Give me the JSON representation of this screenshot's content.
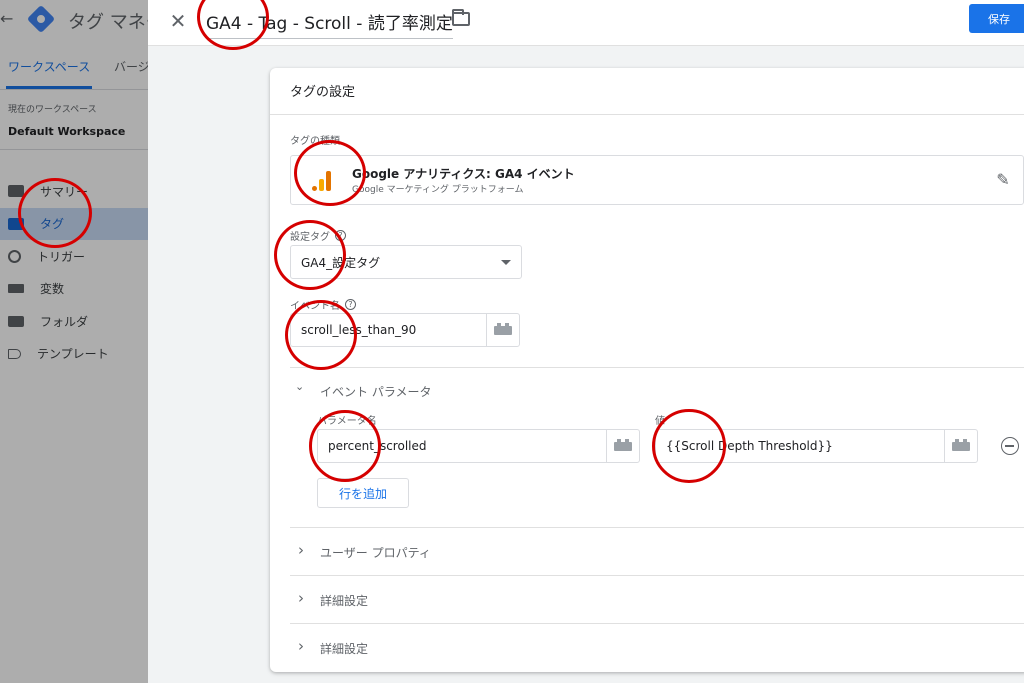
{
  "background_app": {
    "back_glyph": "←",
    "title": "タグ マネー",
    "tabs": [
      "ワークスペース",
      "バージ"
    ],
    "workspace_label": "現在のワークスペース",
    "workspace_name": "Default Workspace",
    "nav_items": [
      {
        "label": "サマリー",
        "icon": "briefcase-icon"
      },
      {
        "label": "タグ",
        "icon": "tag-icon",
        "selected": true
      },
      {
        "label": "トリガー",
        "icon": "trigger-icon"
      },
      {
        "label": "変数",
        "icon": "variables-icon"
      },
      {
        "label": "フォルダ",
        "icon": "folder-icon"
      },
      {
        "label": "テンプレート",
        "icon": "template-icon"
      }
    ]
  },
  "header": {
    "close_glyph": "✕",
    "tag_name": "GA4 - Tag - Scroll - 読了率測定",
    "save_label": "保存"
  },
  "tag_config": {
    "title": "タグの設定",
    "tag_type_label": "タグの種類",
    "tag_type_name": "Google アナリティクス: GA4 イベント",
    "tag_type_sub": "Google マーケティング プラットフォーム",
    "config_tag_label": "設定タグ",
    "config_tag_value": "GA4_設定タグ",
    "event_name_label": "イベント名",
    "event_name_value": "scroll_less_than_90",
    "event_params_title": "イベント パラメータ",
    "param_name_header": "パラメータ名",
    "value_header": "値",
    "params": [
      {
        "name": "percent_scrolled",
        "value": "{{Scroll Depth Threshold}}"
      }
    ],
    "add_row_label": "行を追加",
    "collapsed_sections": [
      "ユーザー プロパティ",
      "詳細設定",
      "詳細設定"
    ]
  },
  "colors": {
    "accent": "#1a73e8",
    "annotation": "#d50000",
    "ga_orange": "#e37400",
    "ga_yellow": "#f9ab00"
  },
  "glyphs": {
    "expand_open": "⌄",
    "expand_closed": "›",
    "edit": "✎",
    "help": "?"
  }
}
